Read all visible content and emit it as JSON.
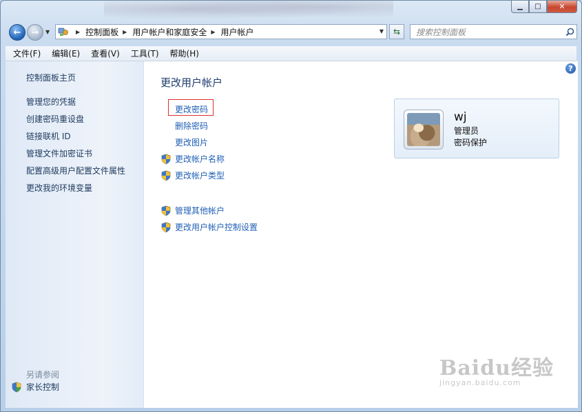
{
  "window": {
    "minimize_icon": "minimize-icon",
    "maximize_icon": "maximize-icon",
    "close_icon": "close-icon"
  },
  "nav": {
    "back_icon": "back-arrow-icon",
    "forward_icon": "forward-arrow-icon",
    "breadcrumbs": [
      "控制面板",
      "用户帐户和家庭安全",
      "用户帐户"
    ],
    "refresh_icon": "refresh-icon",
    "search_placeholder": "搜索控制面板",
    "search_icon": "search-icon"
  },
  "menubar": {
    "items": [
      "文件(F)",
      "编辑(E)",
      "查看(V)",
      "工具(T)",
      "帮助(H)"
    ]
  },
  "sidebar": {
    "links": [
      "控制面板主页",
      "管理您的凭据",
      "创建密码重设盘",
      "链接联机 ID",
      "管理文件加密证书",
      "配置高级用户配置文件属性",
      "更改我的环境变量"
    ],
    "see_also_heading": "另请参阅",
    "see_also_items": [
      "家长控制"
    ]
  },
  "main": {
    "help_label": "?",
    "title": "更改用户帐户",
    "tasks": [
      {
        "label": "更改密码",
        "shield": false,
        "highlighted": true
      },
      {
        "label": "删除密码",
        "shield": false
      },
      {
        "label": "更改图片",
        "shield": false
      },
      {
        "label": "更改帐户名称",
        "shield": true
      },
      {
        "label": "更改帐户类型",
        "shield": true
      }
    ],
    "other_tasks": [
      {
        "label": "管理其他帐户",
        "shield": true
      },
      {
        "label": "更改用户帐户控制设置",
        "shield": true
      }
    ],
    "user": {
      "name": "wj",
      "role": "管理员",
      "protection": "密码保护"
    }
  },
  "watermark": {
    "brand": "Baidu经验",
    "url": "jingyan.baidu.com"
  },
  "colors": {
    "link": "#1f5fb5",
    "highlight_box": "#d9302c",
    "title": "#1e3c6e"
  }
}
